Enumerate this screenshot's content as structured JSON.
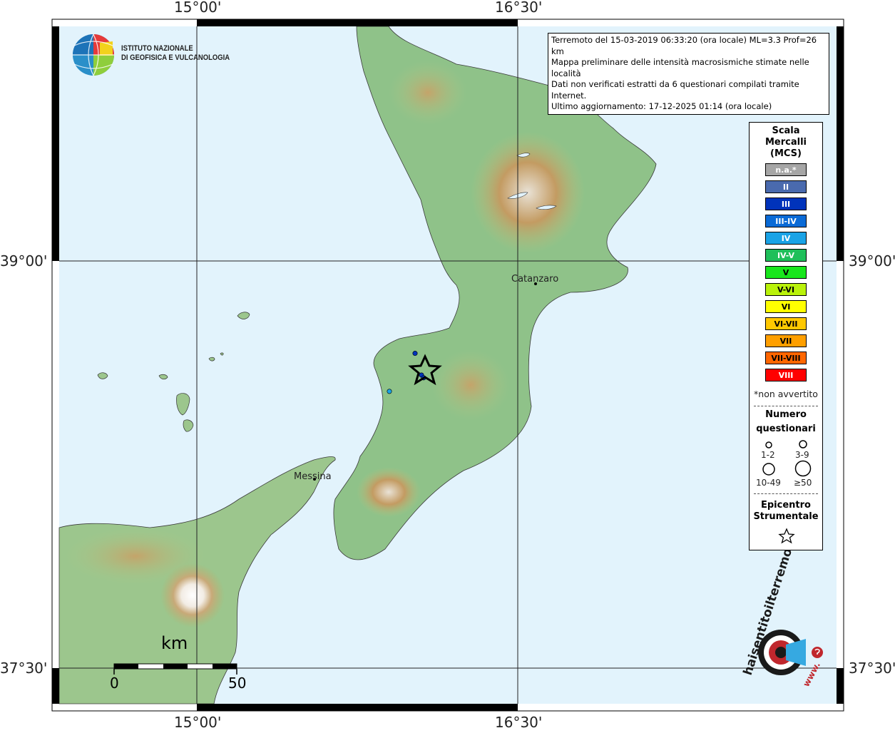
{
  "map": {
    "lon_labels": [
      "15°00'",
      "16°30'"
    ],
    "lat_labels": [
      "39°00'",
      "37°30'"
    ]
  },
  "info": {
    "line1": "Terremoto del 15-03-2019 06:33:20 (ora locale) ML=3.3 Prof=26 km",
    "line2": "Mappa preliminare delle intensità macrosismiche stimate nelle località",
    "line3": "Dati non verificati estratti da 6 questionari compilati tramite Internet.",
    "line4": "Ultimo aggiornamento: 17-12-2025 01:14 (ora locale)"
  },
  "institute": {
    "line1": "ISTITUTO NAZIONALE",
    "line2": "DI GEOFISICA E VULCANOLOGIA"
  },
  "cities": {
    "catanzaro": "Catanzaro",
    "messina": "Messina"
  },
  "legend": {
    "title1": "Scala",
    "title2": "Mercalli",
    "title3": "(MCS)",
    "levels": [
      {
        "label": "n.a.*",
        "color": "#a6a6a6"
      },
      {
        "label": "II",
        "color": "#4a6aae"
      },
      {
        "label": "III",
        "color": "#0033bb"
      },
      {
        "label": "III-IV",
        "color": "#0a6ad6"
      },
      {
        "label": "IV",
        "color": "#1aa3e6"
      },
      {
        "label": "IV-V",
        "color": "#1fbf5a"
      },
      {
        "label": "V",
        "color": "#18e61c"
      },
      {
        "label": "V-VI",
        "color": "#b9f20a"
      },
      {
        "label": "VI",
        "color": "#ffff00"
      },
      {
        "label": "VI-VII",
        "color": "#ffc800"
      },
      {
        "label": "VII",
        "color": "#ff9f00"
      },
      {
        "label": "VII-VIII",
        "color": "#ff6600"
      },
      {
        "label": "VIII",
        "color": "#ff0000"
      }
    ],
    "not_felt": "*non avvertito",
    "count_title1": "Numero",
    "count_title2": "questionari",
    "count_sizes": [
      "1-2",
      "3-9",
      "10-49",
      "≥50"
    ],
    "epicenter1": "Epicentro",
    "epicenter2": "Strumentale"
  },
  "scale_bar": {
    "unit": "km",
    "start": "0",
    "end": "50"
  },
  "website": {
    "text": "haisentitoilterremoto.it",
    "www": "www."
  },
  "observations": {
    "count": 6,
    "points": [
      {
        "lon": 16.02,
        "lat": 38.66,
        "intensity": "III"
      },
      {
        "lon": 16.05,
        "lat": 38.58,
        "intensity": "III"
      },
      {
        "lon": 16.06,
        "lat": 38.57,
        "intensity": "III"
      },
      {
        "lon": 15.9,
        "lat": 38.52,
        "intensity": "IV"
      }
    ]
  }
}
